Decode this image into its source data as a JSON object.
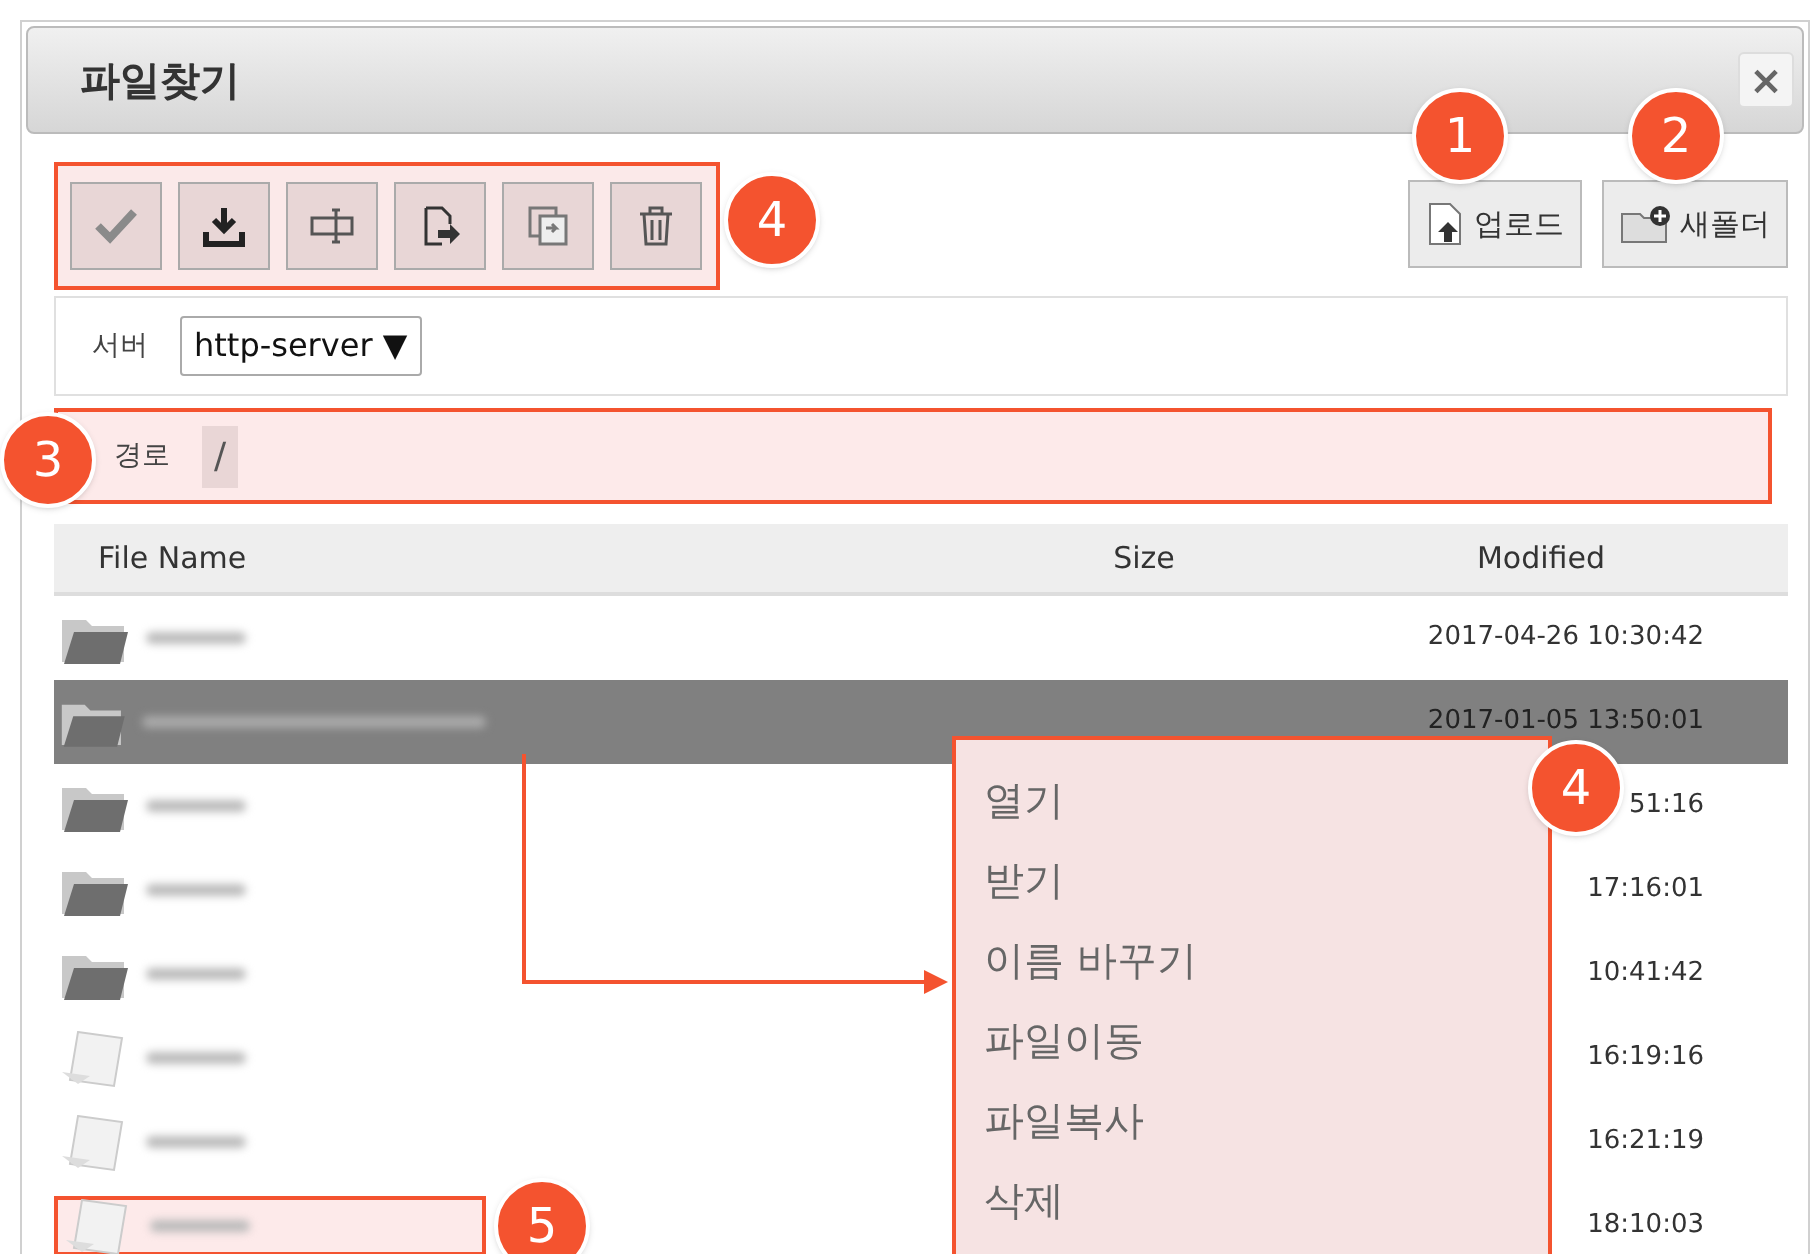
{
  "window": {
    "title": "파일찾기",
    "close": "×"
  },
  "toolbar": {
    "callout": "4",
    "buttons": [
      {
        "kind": "check"
      },
      {
        "kind": "download"
      },
      {
        "kind": "rename"
      },
      {
        "kind": "move"
      },
      {
        "kind": "copy"
      },
      {
        "kind": "delete"
      }
    ]
  },
  "actions": [
    {
      "label": "업로드",
      "kind": "upload",
      "callout": "1"
    },
    {
      "label": "새폴더",
      "kind": "folder",
      "callout": "2"
    }
  ],
  "server": {
    "label": "서버",
    "value": "http-server",
    "caret": "▼"
  },
  "path": {
    "label": "경로",
    "value": "/",
    "callout": "3"
  },
  "table": {
    "columns": [
      "File Name",
      "Size",
      "Modified"
    ],
    "rows": [
      {
        "kind": "folder",
        "selected": false,
        "highlighted": false,
        "modified": "2017-04-26 10:30:42"
      },
      {
        "kind": "folder",
        "selected": true,
        "highlighted": false,
        "modified": "2017-01-05 13:50:01"
      },
      {
        "kind": "folder",
        "selected": false,
        "highlighted": false,
        "modified": "51:16"
      },
      {
        "kind": "folder",
        "selected": false,
        "highlighted": false,
        "modified": "17:16:01"
      },
      {
        "kind": "folder",
        "selected": false,
        "highlighted": false,
        "modified": "10:41:42"
      },
      {
        "kind": "file",
        "selected": false,
        "highlighted": false,
        "modified": "16:19:16"
      },
      {
        "kind": "file",
        "selected": false,
        "highlighted": false,
        "modified": "16:21:19"
      },
      {
        "kind": "file",
        "selected": false,
        "highlighted": true,
        "modified": "18:10:03",
        "callout": "5"
      }
    ]
  },
  "context_menu": {
    "callout": "4",
    "items": [
      "열기",
      "받기",
      "이름 바꾸기",
      "파일이동",
      "파일복사",
      "삭제"
    ]
  }
}
